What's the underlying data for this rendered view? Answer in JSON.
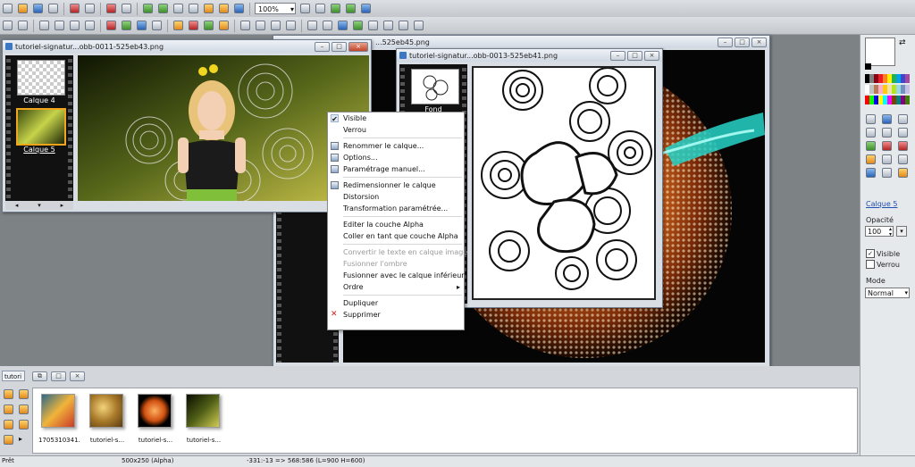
{
  "toolbar": {
    "zoom": "100%"
  },
  "workspace": {
    "window_back": {
      "title": "...525eb45.png"
    },
    "window_left": {
      "title": "tutoriel-signatur...obb-0011-525eb43.png",
      "layers": [
        {
          "label": "Calque 4"
        },
        {
          "label": "Calque 5"
        }
      ]
    },
    "window_center": {
      "title": "tutoriel-signatur...obb-0013-525eb41.png",
      "layer": {
        "label": "Fond"
      }
    }
  },
  "context_menu": {
    "items": [
      {
        "label": "Visible",
        "icon": "checkmark-icon",
        "checked": true,
        "disabled": false
      },
      {
        "label": "Verrou",
        "disabled": false
      },
      {
        "sep": true
      },
      {
        "label": "Renommer le calque...",
        "icon": "rename-icon",
        "disabled": false
      },
      {
        "label": "Options...",
        "icon": "options-icon",
        "disabled": false
      },
      {
        "label": "Paramétrage manuel...",
        "icon": "manual-settings-icon",
        "disabled": false
      },
      {
        "sep": true
      },
      {
        "label": "Redimensionner le calque",
        "icon": "resize-icon",
        "disabled": false
      },
      {
        "label": "Distorsion",
        "disabled": false
      },
      {
        "label": "Transformation paramétrée...",
        "disabled": false
      },
      {
        "sep": true
      },
      {
        "label": "Editer la couche Alpha",
        "disabled": false
      },
      {
        "label": "Coller en tant que couche Alpha",
        "disabled": false
      },
      {
        "sep": true
      },
      {
        "label": "Convertir le texte en calque image",
        "disabled": true
      },
      {
        "label": "Fusionner l'ombre",
        "disabled": true
      },
      {
        "label": "Fusionner avec le calque inférieur",
        "disabled": false
      },
      {
        "label": "Ordre",
        "submenu": true,
        "disabled": false
      },
      {
        "sep": true
      },
      {
        "label": "Dupliquer",
        "disabled": false
      },
      {
        "label": "Supprimer",
        "icon": "delete-x-icon",
        "disabled": false
      }
    ]
  },
  "right_panel": {
    "layer_name": "Calque 5",
    "opacity_label": "Opacité",
    "opacity_value": "100",
    "visible_label": "Visible",
    "visible_checked": true,
    "lock_label": "Verrou",
    "lock_checked": false,
    "mode_label": "Mode",
    "mode_value": "Normal"
  },
  "bottom_panel": {
    "tab_label": "tutori",
    "thumbnails": [
      {
        "caption": "1705310341..."
      },
      {
        "caption": "tutoriel-s..."
      },
      {
        "caption": "tutoriel-s..."
      },
      {
        "caption": "tutoriel-s..."
      }
    ]
  },
  "status": {
    "ready": "Prêt",
    "size": "500x250 (Alpha)",
    "coords": "-331:-13 => 568:586 (L=900  H=600)"
  },
  "palette": [
    "#000000",
    "#7f7f7f",
    "#880015",
    "#ed1c24",
    "#ff7f27",
    "#fff200",
    "#22b14c",
    "#00a2e8",
    "#3f48cc",
    "#a349a4",
    "#ffffff",
    "#c3c3c3",
    "#b97a57",
    "#ffaec9",
    "#ffc90e",
    "#efe4b0",
    "#b5e61d",
    "#99d9ea",
    "#7092be",
    "#c8bfe7",
    "#ff0000",
    "#00ff00",
    "#0000ff",
    "#ffff00",
    "#00ffff",
    "#ff00ff",
    "#804000",
    "#008080",
    "#800080",
    "#408000"
  ]
}
